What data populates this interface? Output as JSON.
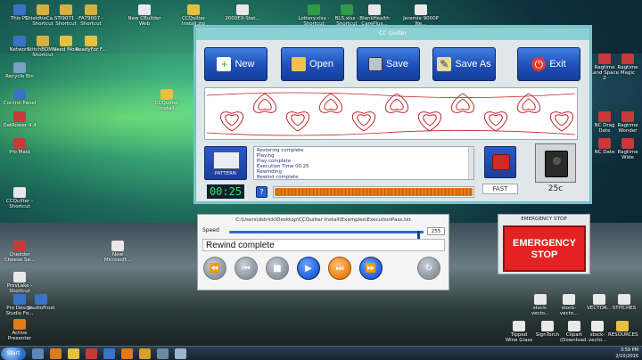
{
  "desktop": {
    "icons": [
      {
        "label": "This PC",
        "color": "#3a72c8"
      },
      {
        "label": "ShieldtieCa... - Shortcut",
        "color": "#d3b144"
      },
      {
        "label": "STI9071 - Shortcut",
        "color": "#d3b144"
      },
      {
        "label": "FA79007 - Shortcut",
        "color": "#d3b144"
      },
      {
        "label": "New CBuilder Web",
        "color": "#e9e9e9"
      },
      {
        "label": "CCQuilter Install.zip",
        "color": "#e6c040"
      },
      {
        "label": "2000EX-Stat...",
        "color": "#e9e9e9"
      },
      {
        "label": "Lottery.xlsx - Shortcut",
        "color": "#2e9a4a"
      },
      {
        "label": "BLS.xlsx - Shortcut",
        "color": "#2e9a4a"
      },
      {
        "label": "BlankHealth CarePlus...",
        "color": "#e9e9e9"
      },
      {
        "label": "Jeremie 9000P Ne...",
        "color": "#e9e9e9"
      },
      {
        "label": "Network",
        "color": "#3a72c8"
      },
      {
        "label": "StitchBOMs - Shortcut",
        "color": "#d3b144"
      },
      {
        "label": "Need More",
        "color": "#e6c040"
      },
      {
        "label": "ReadyFor F...",
        "color": "#e6c040"
      },
      {
        "label": "Recycle Bin",
        "color": "#7aa0c8"
      },
      {
        "label": "Control Panel",
        "color": "#3a72c8"
      },
      {
        "label": "DatRower 4.4",
        "color": "#c83a3a"
      },
      {
        "label": "Pro Maid",
        "color": "#c83a3a"
      },
      {
        "label": "CCQuilter - Shortcut",
        "color": "#e9e9e9"
      },
      {
        "label": "Chedder Cheese Se...",
        "color": "#c83a3a"
      },
      {
        "label": "ProvLake - Shortcut",
        "color": "#e9e9e9"
      },
      {
        "label": "Pro Design Studio Fo...",
        "color": "#3a72c8"
      },
      {
        "label": "StudioFrost",
        "color": "#3a72c8"
      },
      {
        "label": "Active Presenter",
        "color": "#e07a16"
      },
      {
        "label": "New Microsoft...",
        "color": "#e9e9e9"
      },
      {
        "label": "CCQuilter Install",
        "color": "#e6c040"
      }
    ],
    "right_icons": [
      {
        "label": "Ragtime Land Space 2",
        "color": "#c83a3a"
      },
      {
        "label": "Ragtime Magic",
        "color": "#c83a3a"
      },
      {
        "label": "NC Drag Date",
        "color": "#c83a3a"
      },
      {
        "label": "Ragtime Wonder",
        "color": "#c83a3a"
      },
      {
        "label": "NC Date",
        "color": "#c83a3a"
      },
      {
        "label": "Ragtime Wide",
        "color": "#c83a3a"
      },
      {
        "label": "stock-vecto...",
        "color": "#e9e9e9"
      },
      {
        "label": "stock-vecto...",
        "color": "#e9e9e9"
      },
      {
        "label": "VECTOR...",
        "color": "#e9e9e9"
      },
      {
        "label": "STITCHES",
        "color": "#e9e9e9"
      },
      {
        "label": "Tipped Wine Glass",
        "color": "#e9e9e9"
      },
      {
        "label": "SignTorch",
        "color": "#e9e9e9"
      },
      {
        "label": "Clipart (Download...",
        "color": "#e9e9e9"
      },
      {
        "label": "stock-vecto...",
        "color": "#e9e9e9"
      },
      {
        "label": "RESOURCES",
        "color": "#e6c040"
      }
    ]
  },
  "app": {
    "title": "CC Quilter",
    "toolbar": {
      "new_label": "New",
      "open_label": "Open",
      "save_label": "Save",
      "saveas_label": "Save As",
      "exit_label": "Exit"
    },
    "pattern_label": "PATTERN",
    "log_lines": [
      "Restoring complete",
      "Playing",
      "Play complete",
      "Execution Time 00:25",
      "Rewinding",
      "Rewind complete"
    ],
    "speed_label": "FAST",
    "temperature": "25c",
    "timer": "00:25",
    "help_label": "?",
    "progress": 1.0
  },
  "controls": {
    "file_path": "C:\\Users\\dstrick\\Desktop\\CCQuilter Install\\Examples\\ExecutionPass.txt",
    "speed_label": "Speed",
    "speed_value": "255",
    "speed_fraction": 0.98,
    "status": "Rewind complete"
  },
  "emergency": {
    "header": "EMERGENCY STOP",
    "line1": "EMERGENCY",
    "line2": "STOP"
  },
  "taskbar": {
    "start_label": "Start",
    "time": "3:59 PM",
    "date": "2/10/2016"
  }
}
